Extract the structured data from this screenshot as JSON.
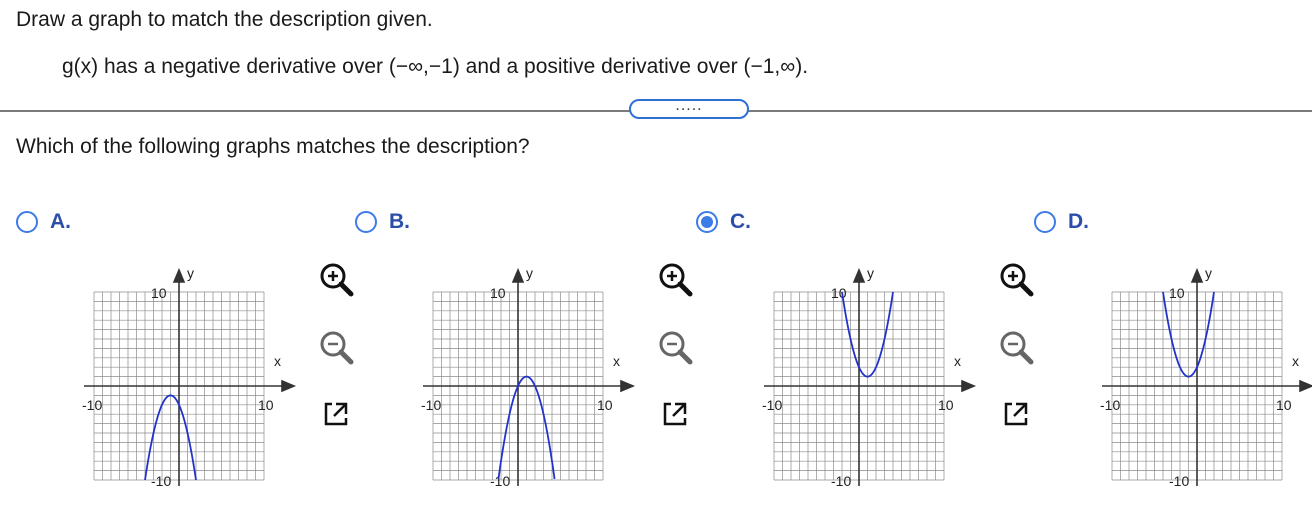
{
  "header": {
    "prompt": "Draw a graph to match the description given.",
    "description": "g(x) has a negative derivative over (−∞,−1) and a positive derivative over (−1,∞).",
    "expand_label": "....."
  },
  "question": "Which of the following graphs matches the description?",
  "colors": {
    "accent": "#3c7be8",
    "curve": "#2233cc",
    "grid": "#8c8c8c"
  },
  "axes": {
    "x_label": "x",
    "y_label": "y",
    "x_min_label": "-10",
    "x_max_label": "10",
    "y_max_label": "10",
    "y_min_label": "-10"
  },
  "tool_icons": [
    "zoom-in-icon",
    "zoom-out-icon",
    "open-new-window-icon"
  ],
  "options": [
    {
      "letter": "A.",
      "selected": false,
      "curve": "downward parabola, vertex (-1,-1)"
    },
    {
      "letter": "B.",
      "selected": false,
      "curve": "downward parabola, vertex (1,1)"
    },
    {
      "letter": "C.",
      "selected": true,
      "curve": "upward parabola, vertex (1,1)"
    },
    {
      "letter": "D.",
      "selected": false,
      "curve": "upward parabola, vertex (-1,1)"
    }
  ]
}
